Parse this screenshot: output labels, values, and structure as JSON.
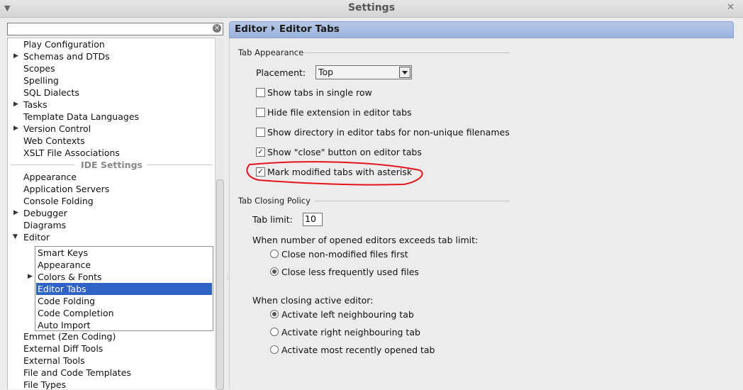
{
  "window": {
    "title": "Settings"
  },
  "search": {
    "value": "",
    "placeholder": ""
  },
  "tree": {
    "items_top": [
      {
        "label": "Play Configuration",
        "expandable": false
      },
      {
        "label": "Schemas and DTDs",
        "expandable": true
      },
      {
        "label": "Scopes",
        "expandable": false
      },
      {
        "label": "Spelling",
        "expandable": false
      },
      {
        "label": "SQL Dialects",
        "expandable": false
      },
      {
        "label": "Tasks",
        "expandable": true
      },
      {
        "label": "Template Data Languages",
        "expandable": false
      },
      {
        "label": "Version Control",
        "expandable": true
      },
      {
        "label": "Web Contexts",
        "expandable": false
      },
      {
        "label": "XSLT File Associations",
        "expandable": false
      }
    ],
    "section_label": "IDE Settings",
    "items_ide": [
      {
        "label": "Appearance"
      },
      {
        "label": "Application Servers"
      },
      {
        "label": "Console Folding"
      },
      {
        "label": "Debugger"
      },
      {
        "label": "Diagrams"
      },
      {
        "label": "Editor"
      }
    ],
    "editor_children": [
      {
        "label": "Smart Keys"
      },
      {
        "label": "Appearance"
      },
      {
        "label": "Colors & Fonts"
      },
      {
        "label": "Editor Tabs"
      },
      {
        "label": "Code Folding"
      },
      {
        "label": "Code Completion"
      },
      {
        "label": "Auto Import"
      }
    ],
    "items_bottom": [
      {
        "label": "Emmet (Zen Coding)"
      },
      {
        "label": "External Diff Tools"
      },
      {
        "label": "External Tools"
      },
      {
        "label": "File and Code Templates"
      },
      {
        "label": "File Types"
      }
    ]
  },
  "breadcrumb": {
    "parent": "Editor",
    "current": "Editor Tabs"
  },
  "tab_appearance": {
    "title": "Tab Appearance",
    "placement_label": "Placement:",
    "placement_value": "Top",
    "checkboxes": [
      {
        "label": "Show tabs in single row",
        "checked": false
      },
      {
        "label": "Hide file extension in editor tabs",
        "checked": false
      },
      {
        "label": "Show directory in editor tabs for non-unique filenames",
        "checked": false
      },
      {
        "label": "Show \"close\" button on editor tabs",
        "checked": true
      },
      {
        "label": "Mark modified tabs with asterisk",
        "checked": true
      }
    ]
  },
  "tab_closing": {
    "title": "Tab Closing Policy",
    "tab_limit_label": "Tab limit:",
    "tab_limit_value": "10",
    "exceeds_label": "When number of opened editors exceeds tab limit:",
    "exceeds_options": [
      {
        "label": "Close non-modified files first",
        "selected": false
      },
      {
        "label": "Close less frequently used files",
        "selected": true
      }
    ],
    "closing_label": "When closing active editor:",
    "closing_options": [
      {
        "label": "Activate left neighbouring tab",
        "selected": true
      },
      {
        "label": "Activate right neighbouring tab",
        "selected": false
      },
      {
        "label": "Activate most recently opened tab",
        "selected": false
      }
    ]
  },
  "colors": {
    "selection": "#2f62c7",
    "annotation": "#e0141a",
    "header": "#a9bfe2"
  },
  "check_glyph": "✓"
}
